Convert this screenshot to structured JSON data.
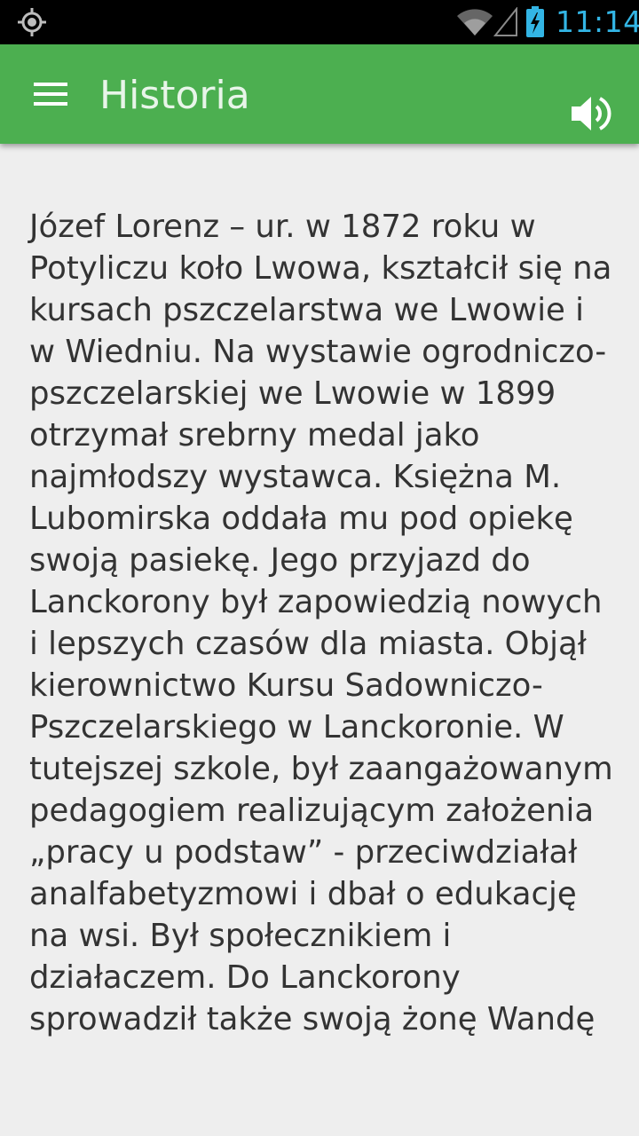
{
  "status_bar": {
    "time": "11:14",
    "icons": [
      "gps-icon",
      "wifi-icon",
      "signal-icon",
      "battery-charging-icon"
    ],
    "time_color": "#33b5e5"
  },
  "toolbar": {
    "title": "Historia",
    "menu_icon": "hamburger-menu-icon",
    "action_icon": "volume-icon",
    "background_color": "#4caf50"
  },
  "article": {
    "text": "Józef Lorenz – ur. w 1872 roku w Potyliczu koło Lwowa, kształcił się na kursach pszczelarstwa we Lwowie i w Wiedniu. Na wystawie ogrodniczo-pszczelarskiej we Lwowie w 1899 otrzymał srebrny medal jako najmłodszy wystawca. Księżna M. Lubomirska oddała mu pod opiekę swoją pasiekę. Jego przyjazd do Lanckorony był zapowiedzią nowych i lepszych czasów dla miasta. Objął kierownictwo Kursu Sadowniczo-Pszczelarskiego w Lanckoronie. W tutejszej szkole, był zaangażowanym pedagogiem realizującym założenia „pracy u podstaw” - przeciwdziałał analfabetyzmowi i dbał o edukację na wsi. Był społecznikiem i działaczem. Do Lanckorony sprowadził także swoją żonę Wandę"
  }
}
